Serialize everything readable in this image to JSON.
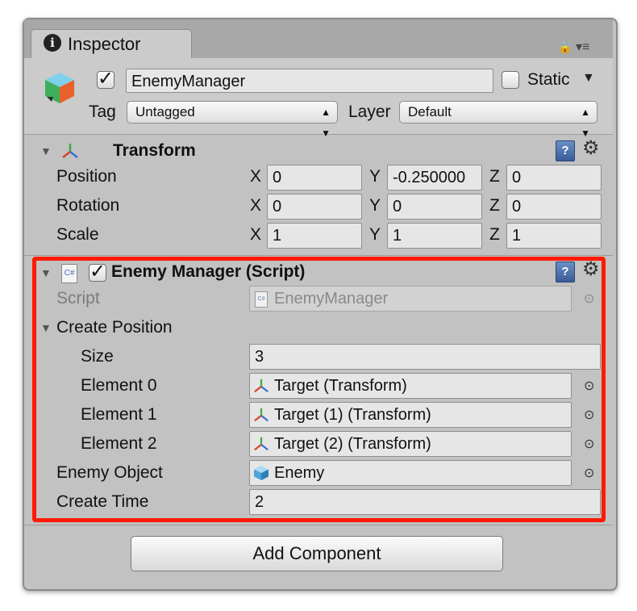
{
  "window": {
    "tab_title": "Inspector"
  },
  "gameobject": {
    "active": true,
    "name": "EnemyManager",
    "static_label": "Static",
    "static_checked": false,
    "tag_label": "Tag",
    "tag_value": "Untagged",
    "layer_label": "Layer",
    "layer_value": "Default"
  },
  "transform": {
    "title": "Transform",
    "rows": [
      {
        "label": "Position",
        "x": "0",
        "y": "-0.250000",
        "z": "0"
      },
      {
        "label": "Rotation",
        "x": "0",
        "y": "0",
        "z": "0"
      },
      {
        "label": "Scale",
        "x": "1",
        "y": "1",
        "z": "1"
      }
    ],
    "axis_labels": {
      "x": "X",
      "y": "Y",
      "z": "Z"
    }
  },
  "script_component": {
    "enabled": true,
    "title": "Enemy Manager (Script)",
    "script_label": "Script",
    "script_value": "EnemyManager",
    "create_position_label": "Create Position",
    "size_label": "Size",
    "size_value": "3",
    "elements": [
      {
        "label": "Element 0",
        "value": "Target (Transform)"
      },
      {
        "label": "Element 1",
        "value": "Target (1) (Transform)"
      },
      {
        "label": "Element 2",
        "value": "Target (2) (Transform)"
      }
    ],
    "enemy_object_label": "Enemy Object",
    "enemy_object_value": "Enemy",
    "create_time_label": "Create Time",
    "create_time_value": "2"
  },
  "add_component_label": "Add Component",
  "colors": {
    "highlight": "#ff1a00",
    "panel": "#c2c2c2"
  }
}
